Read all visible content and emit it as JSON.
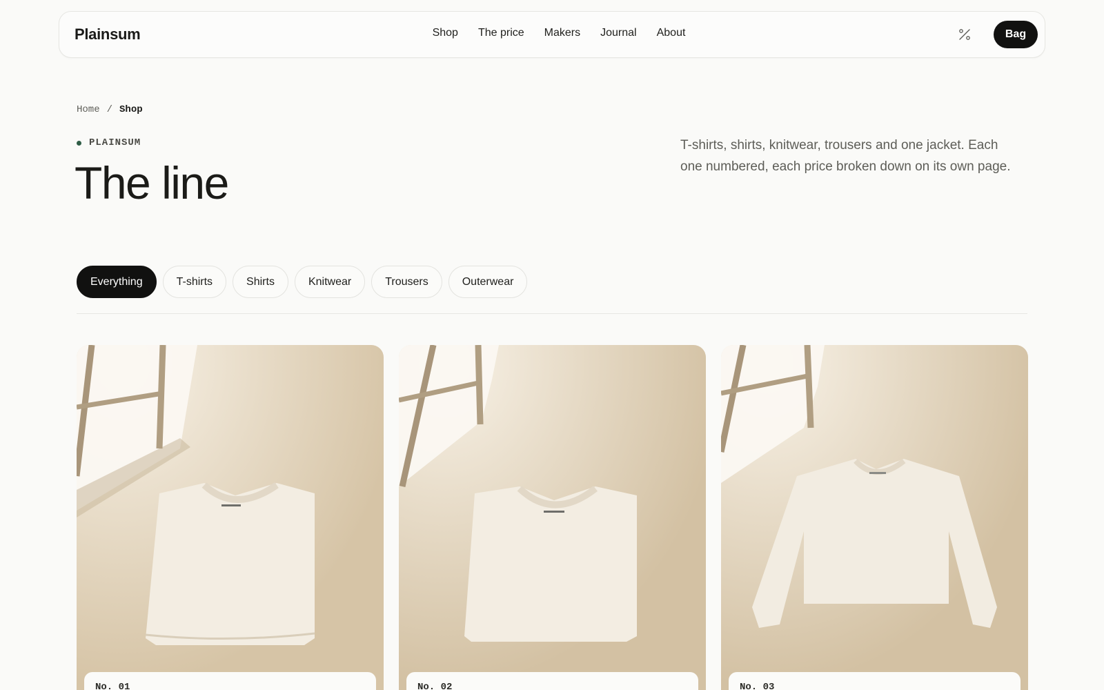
{
  "header": {
    "logo": "Plainsum",
    "nav": [
      "Shop",
      "The price",
      "Makers",
      "Journal",
      "About"
    ],
    "theme_icon": "percent-slash-icon",
    "bag_label": "Bag"
  },
  "breadcrumb": {
    "home": "Home",
    "separator": "/",
    "current": "Shop"
  },
  "hero": {
    "eyebrow": "PLAINSUM",
    "title": "The line",
    "intro": "T-shirts, shirts, knitwear, trousers and one jacket. Each one numbered, each price broken down on its own page."
  },
  "filters": {
    "options": [
      "Everything",
      "T-shirts",
      "Shirts",
      "Knitwear",
      "Trousers",
      "Outerwear"
    ],
    "selected": "Everything"
  },
  "products": [
    {
      "number": "No. 01",
      "image": "folded-tshirt-image"
    },
    {
      "number": "No. 02",
      "image": "folded-tshirt-image"
    },
    {
      "number": "No. 03",
      "image": "longsleeve-tshirt-image"
    }
  ],
  "colors": {
    "background": "#fafaf8",
    "accent_dark": "#111110",
    "eyebrow_dot": "#2f5d46"
  }
}
